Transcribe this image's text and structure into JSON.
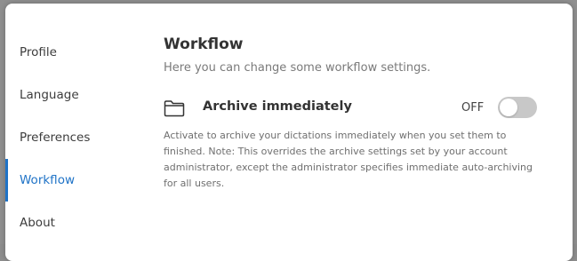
{
  "sidebar": {
    "items": [
      {
        "label": "Profile"
      },
      {
        "label": "Language"
      },
      {
        "label": "Preferences"
      },
      {
        "label": "Workflow"
      },
      {
        "label": "About"
      }
    ],
    "active": "Workflow"
  },
  "main": {
    "title": "Workflow",
    "subtitle": "Here you can change some workflow settings.",
    "settings": [
      {
        "icon": "folder-icon",
        "label": "Archive immediately",
        "state": "OFF",
        "description": "Activate to archive your dictations immediately when you set them to finished. Note: This overrides the archive settings set by your account administrator, except the administrator specifies immediate auto-archiving for all users."
      }
    ]
  },
  "colors": {
    "accent": "#1f73c7",
    "toggle_off": "#c8c8c8"
  }
}
